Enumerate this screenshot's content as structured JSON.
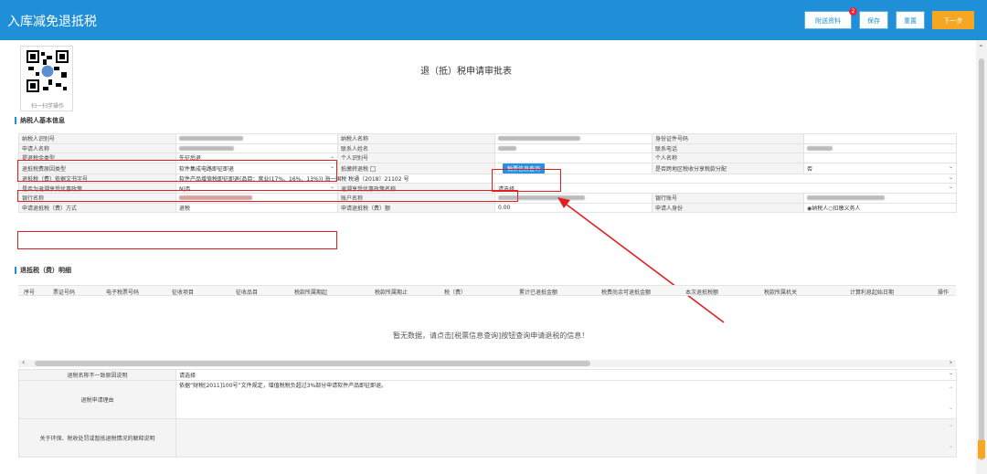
{
  "header": {
    "title": "入库减免退抵税",
    "attach_label": "附送资料",
    "attach_badge": "2",
    "save_label": "保存",
    "reset_label": "重置",
    "next_label": "下一步"
  },
  "qr": {
    "caption": "扫一扫学操作"
  },
  "form_title": "退（抵）税申请审批表",
  "section1": "纳税人基本信息",
  "basic": {
    "r1": {
      "l1": "纳税人识别号",
      "l2": "纳税人名称",
      "l3": "身份证件号码"
    },
    "r2": {
      "l1": "申请人名称",
      "l2": "联系人姓名",
      "l3": "联系电话"
    },
    "r3": {
      "l1": "提退税金类型",
      "v1": "先征后退",
      "l2": "个人识别号",
      "l3": "个人名称"
    },
    "r4": {
      "l1": "退抵税费原因类型",
      "v1": "软件集成电路即征即退",
      "l2": "抵缴转退税",
      "btn": "税票信息查询",
      "l3": "是否跨地区税收分享税款分配",
      "v3": "否"
    },
    "r5": {
      "l1": "退抵税（费）依据文书字号",
      "v1": "软件产品增值税即征即退(品目：席业(17%、16%、13%)) 海一国税 税通〔2018〕21102 号"
    },
    "r6": {
      "l1": "是否为退溯享受优惠政策",
      "v1": "N|否",
      "l2": "退溯享受优惠政策名称",
      "v2": "请选择"
    },
    "r7": {
      "l1": "银行名称",
      "l2": "账户名称",
      "l3": "银行账号"
    },
    "r8": {
      "l1": "申请退抵税（费）方式",
      "v1": "退税",
      "l2": "申请退抵税（费）额",
      "v2": "0.00",
      "l3": "申请人身份",
      "radio1": "纳税人",
      "radio2": "扣缴义务人"
    }
  },
  "section2": "退抵税（费）明细",
  "detail_headers": [
    "序号",
    "票证号码",
    "电子税票号码",
    "征收项目",
    "征收品目",
    "税款所属期起",
    "税款所属期止",
    "税（费）",
    "累计已退抵金额",
    "税费尚余可退抵金额",
    "本次退抵税额",
    "税款所属机关",
    "计算利息起始日期",
    "操作"
  ],
  "empty_msg": "暂无数据，请点击[税票信息查询]按钮查询申请退税的信息！",
  "bottom": {
    "l1": "退税名称不一致原因说明",
    "v1": "请选择",
    "l2": "退税申请理由",
    "v2": "依据“财税[2011]100号”文件规定，增值税税负超过3%部分申请软件产品即征即退。",
    "l3": "关于环保、税收处罚或暂抵退税情况的解释说明"
  }
}
